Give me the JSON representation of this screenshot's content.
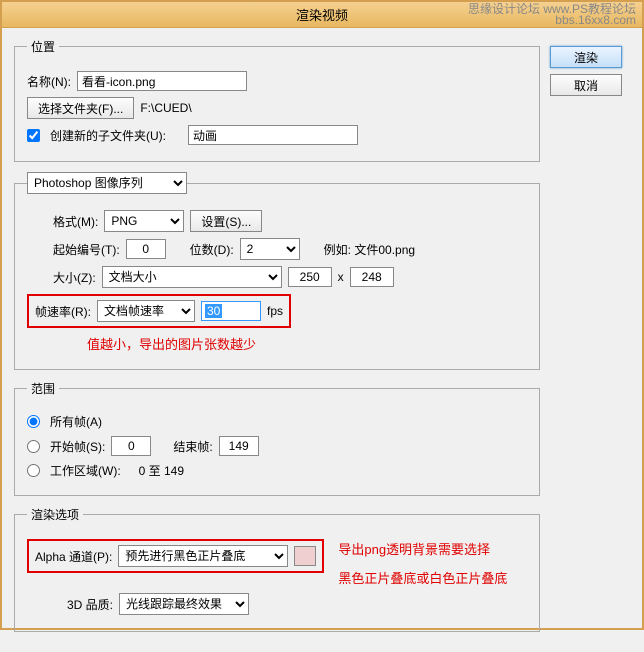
{
  "title": "渲染视频",
  "watermark_top": "思缘设计论坛   www.PS教程论坛",
  "watermark_bottom": "bbs.16xx8.com",
  "buttons": {
    "render": "渲染",
    "cancel": "取消"
  },
  "location": {
    "legend": "位置",
    "name_label": "名称(N):",
    "name_value": "看看-icon.png",
    "select_folder_btn": "选择文件夹(F)...",
    "folder_path": "F:\\CUED\\",
    "create_subfolder_label": "创建新的子文件夹(U):",
    "subfolder_value": "动画"
  },
  "sequence": {
    "type_select": "Photoshop 图像序列",
    "format_label": "格式(M):",
    "format_value": "PNG",
    "settings_btn": "设置(S)...",
    "start_num_label": "起始编号(T):",
    "start_num_value": "0",
    "digits_label": "位数(D):",
    "digits_value": "2",
    "example_label": "例如: 文件00.png",
    "size_label": "大小(Z):",
    "size_select": "文档大小",
    "width": "250",
    "x": "x",
    "height": "248",
    "framerate_label": "帧速率(R):",
    "framerate_select": "文档帧速率",
    "framerate_value": "30",
    "fps": "fps",
    "note": "值越小，导出的图片张数越少"
  },
  "range": {
    "legend": "范围",
    "all_frames": "所有帧(A)",
    "start_frame_label": "开始帧(S):",
    "start_frame_value": "0",
    "end_frame_label": "结束帧:",
    "end_frame_value": "149",
    "work_area_label": "工作区域(W):",
    "work_area_value": "0 至 149"
  },
  "render_opts": {
    "legend": "渲染选项",
    "alpha_label": "Alpha 通道(P):",
    "alpha_value": "预先进行黑色正片叠底",
    "note1": "导出png透明背景需要选择",
    "note2": "黑色正片叠底或白色正片叠底",
    "quality_label": "3D 品质:",
    "quality_value": "光线跟踪最终效果"
  }
}
